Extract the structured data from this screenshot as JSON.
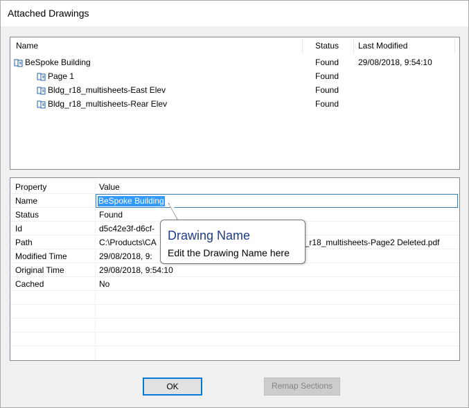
{
  "window": {
    "title": "Attached Drawings"
  },
  "drawings_list": {
    "columns": [
      "Name",
      "Status",
      "Last Modified"
    ],
    "rows": [
      {
        "name": "BeSpoke Building",
        "status": "Found",
        "last_modified": "29/08/2018, 9:54:10",
        "level": 0
      },
      {
        "name": "Page 1",
        "status": "Found",
        "last_modified": "",
        "level": 1
      },
      {
        "name": "Bldg_r18_multisheets-East Elev",
        "status": "Found",
        "last_modified": "",
        "level": 1
      },
      {
        "name": "Bldg_r18_multisheets-Rear Elev",
        "status": "Found",
        "last_modified": "",
        "level": 1
      }
    ],
    "icon": "drawing-icon"
  },
  "properties": {
    "header": {
      "property": "Property",
      "value": "Value"
    },
    "rows": [
      {
        "name": "Name",
        "value": "BeSpoke Building"
      },
      {
        "name": "Status",
        "value": "Found"
      },
      {
        "name": "Id",
        "value": "d5c42e3f-d6cf-"
      },
      {
        "name": "Path",
        "value": "C:\\Products\\CA"
      },
      {
        "name": "Modified Time",
        "value": "29/08/2018, 9:"
      },
      {
        "name": "Original Time",
        "value": "29/08/2018, 9:54:10"
      },
      {
        "name": "Cached",
        "value": "No"
      }
    ],
    "path_tail": "g_r18_multisheets-Page2 Deleted.pdf"
  },
  "tooltip": {
    "title": "Drawing Name",
    "body": "Edit the Drawing Name here"
  },
  "buttons": {
    "ok": "OK",
    "remap": "Remap Sections"
  },
  "colors": {
    "accent": "#0078d7",
    "selection": "#3399ff",
    "tooltip_title": "#1f3c88"
  }
}
